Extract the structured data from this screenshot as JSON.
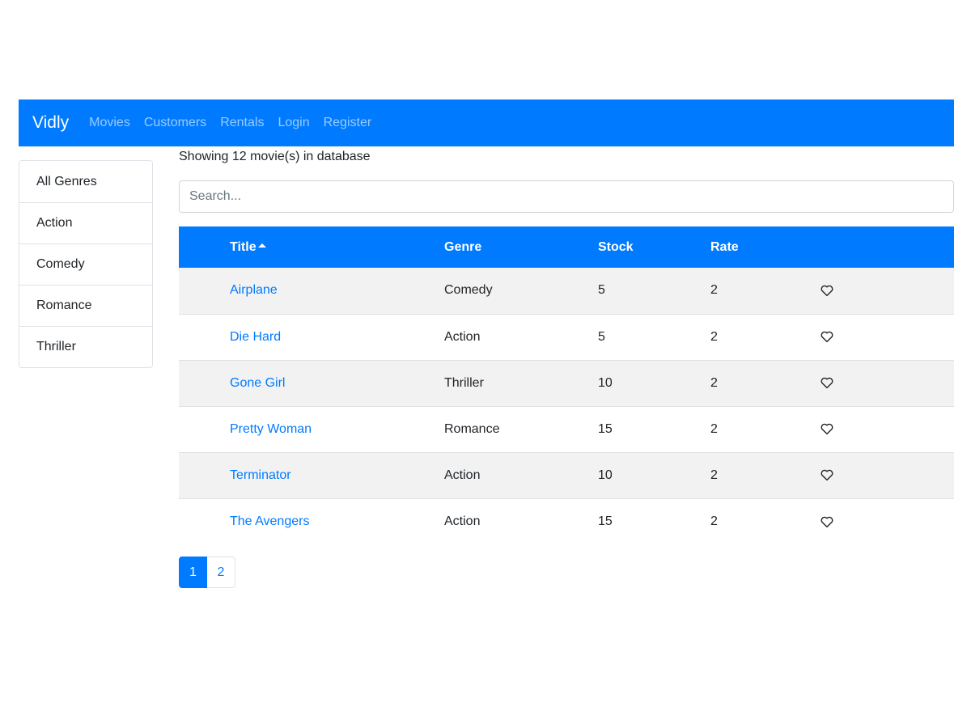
{
  "navbar": {
    "brand": "Vidly",
    "links": [
      "Movies",
      "Customers",
      "Rentals",
      "Login",
      "Register"
    ]
  },
  "genres": [
    "All Genres",
    "Action",
    "Comedy",
    "Romance",
    "Thriller"
  ],
  "summary": "Showing 12 movie(s) in database",
  "search": {
    "placeholder": "Search..."
  },
  "table": {
    "columns": {
      "title": "Title",
      "genre": "Genre",
      "stock": "Stock",
      "rate": "Rate"
    },
    "rows": [
      {
        "title": "Airplane",
        "genre": "Comedy",
        "stock": "5",
        "rate": "2"
      },
      {
        "title": "Die Hard",
        "genre": "Action",
        "stock": "5",
        "rate": "2"
      },
      {
        "title": "Gone Girl",
        "genre": "Thriller",
        "stock": "10",
        "rate": "2"
      },
      {
        "title": "Pretty Woman",
        "genre": "Romance",
        "stock": "15",
        "rate": "2"
      },
      {
        "title": "Terminator",
        "genre": "Action",
        "stock": "10",
        "rate": "2"
      },
      {
        "title": "The Avengers",
        "genre": "Action",
        "stock": "15",
        "rate": "2"
      }
    ],
    "sort_icon": "caret-up-icon",
    "like_icon": "heart-outline-icon"
  },
  "pagination": {
    "pages": [
      "1",
      "2"
    ],
    "current": "1"
  },
  "colors": {
    "primary": "#007bff",
    "striped_row": "#f2f2f2"
  }
}
